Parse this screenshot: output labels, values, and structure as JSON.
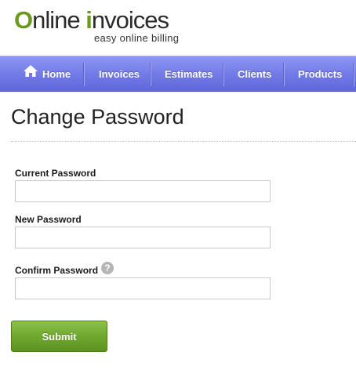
{
  "logo": {
    "first_letter": "O",
    "name_part1": "nline ",
    "i_letter": "i",
    "name_part2": "nvoices",
    "tagline": "easy online billing"
  },
  "nav": {
    "items": [
      {
        "label": "Home",
        "icon": "home-icon"
      },
      {
        "label": "Invoices"
      },
      {
        "label": "Estimates"
      },
      {
        "label": "Clients"
      },
      {
        "label": "Products"
      }
    ]
  },
  "page": {
    "title": "Change Password"
  },
  "form": {
    "current_password_label": "Current Password",
    "current_password_value": "",
    "new_password_label": "New Password",
    "new_password_value": "",
    "confirm_password_label": "Confirm Password",
    "confirm_password_value": "",
    "help_icon": "?",
    "submit_label": "Submit"
  },
  "colors": {
    "brand_green": "#6b9a1e",
    "nav_blue": "#7079e6",
    "button_green": "#6fa82f"
  }
}
